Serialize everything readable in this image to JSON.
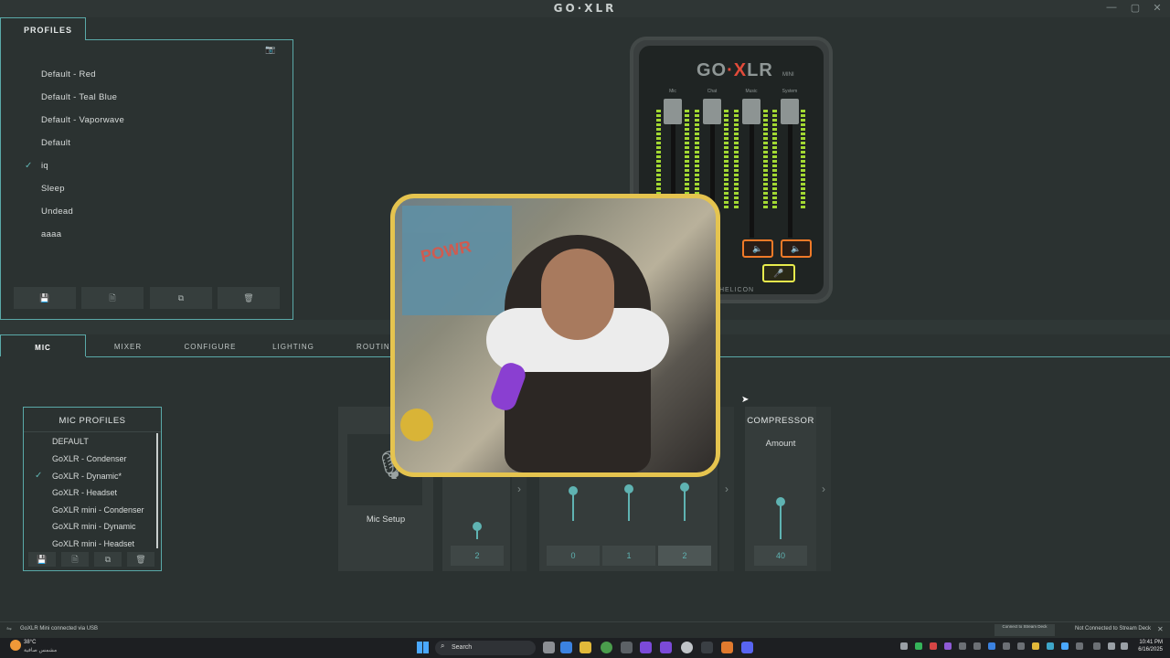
{
  "app": {
    "title": "GO·XLR"
  },
  "window_controls": {
    "minimize": "—",
    "maximize": "▢",
    "close": "✕"
  },
  "profiles": {
    "tab_label": "PROFILES",
    "items": [
      "Default - Red",
      "Default - Teal Blue",
      "Default - Vaporwave",
      "Default",
      "iq",
      "Sleep",
      "Undead",
      "aaaa"
    ],
    "active": "iq",
    "buttons": {
      "save": "💾",
      "new": "🗎",
      "copy": "⧉",
      "delete": "🗑"
    }
  },
  "device": {
    "logo_left": "GO",
    "logo_x": "·X",
    "logo_right": "LR",
    "model": "MINI",
    "channels": [
      "Mic",
      "Chat",
      "Music",
      "System"
    ],
    "brand": "HELICON",
    "mute_glyph": "🔈",
    "mic_glyph": "🎤"
  },
  "tabs": [
    "MIC",
    "MIXER",
    "CONFIGURE",
    "LIGHTING",
    "ROUTING"
  ],
  "active_tab": "MIC",
  "mic_profiles": {
    "title": "MIC PROFILES",
    "items": [
      "DEFAULT",
      "GoXLR - Condenser",
      "GoXLR - Dynamic*",
      "GoXLR - Headset",
      "GoXLR mini - Condenser",
      "GoXLR mini - Dynamic",
      "GoXLR mini - Headset"
    ],
    "active": "GoXLR - Dynamic*"
  },
  "mic_setup": {
    "label": "Mic Setup"
  },
  "sections": {
    "section_a": {
      "values": [
        "2"
      ],
      "levels": [
        0.15
      ]
    },
    "section_b": {
      "values": [
        "0",
        "1",
        "2"
      ],
      "levels": [
        0.7,
        0.75,
        0.8
      ]
    },
    "compressor": {
      "title": "COMPRESSOR",
      "amount_label": "Amount",
      "value": "40",
      "level": 0.45
    }
  },
  "webcam": {
    "poster_text": "POWR"
  },
  "status": {
    "left": "GoXLR Mini connected via USB",
    "button": "Connect to Stream Deck",
    "right": "Not Connected to Stream Deck"
  },
  "taskbar": {
    "weather_temp": "38°C",
    "weather_desc": "مشمس صافية",
    "search": "Search",
    "time": "10:41 PM",
    "date": "6/16/2025"
  }
}
